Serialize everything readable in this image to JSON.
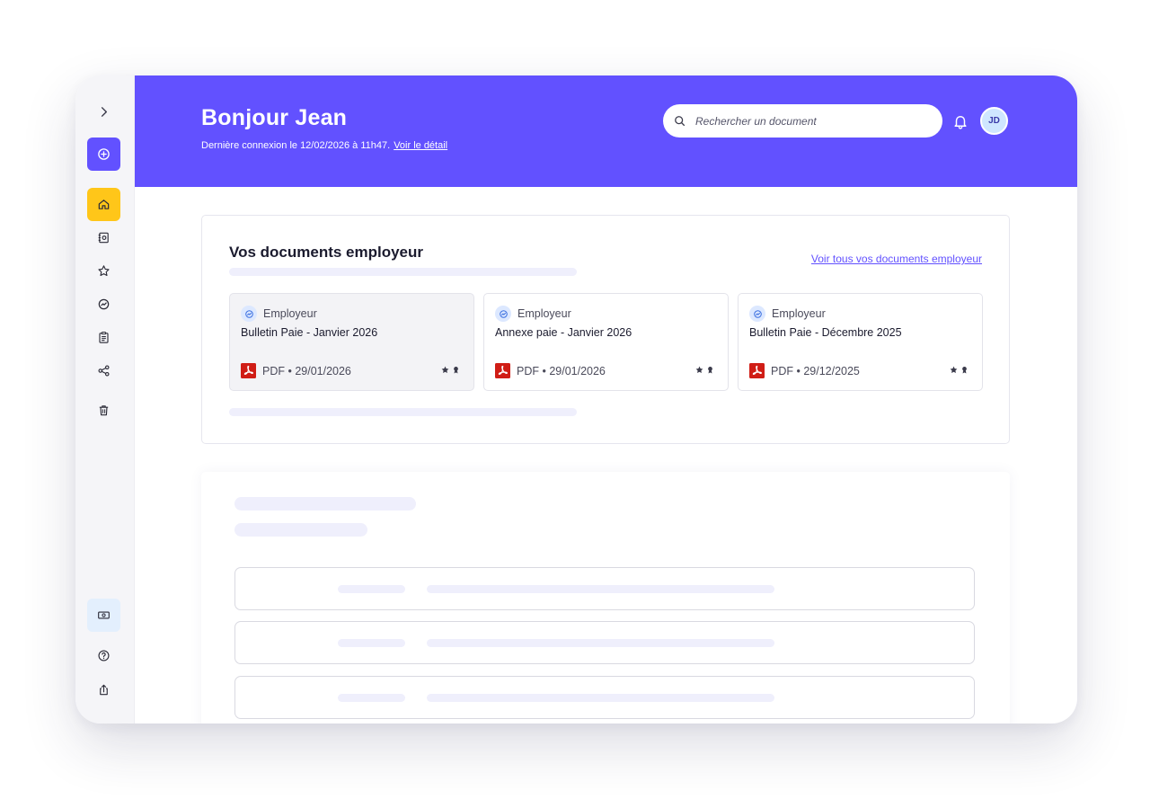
{
  "header": {
    "greeting": "Bonjour Jean",
    "last_login": "Dernière connexion le 12/02/2026 à 11h47.",
    "detail_link": "Voir le détail",
    "search_placeholder": "Rechercher un document",
    "avatar_initials": "JD",
    "accent_color": "#6251ff"
  },
  "sidebar": {
    "items": [
      {
        "icon": "chevron-right-icon",
        "state": "default"
      },
      {
        "icon": "add-circle-icon",
        "state": "primary"
      },
      {
        "icon": "home-icon",
        "state": "active"
      },
      {
        "icon": "document-icon",
        "state": "default"
      },
      {
        "icon": "star-icon",
        "state": "default"
      },
      {
        "icon": "partners-icon",
        "state": "default"
      },
      {
        "icon": "clipboard-icon",
        "state": "default"
      },
      {
        "icon": "share-icon",
        "state": "default"
      },
      {
        "icon": "trash-icon",
        "state": "default"
      }
    ],
    "bottom_items": [
      {
        "icon": "banknote-icon",
        "state": "highlight"
      },
      {
        "icon": "help-icon",
        "state": "default"
      },
      {
        "icon": "export-icon",
        "state": "default"
      }
    ],
    "active_color": "#ffc619"
  },
  "employer_documents": {
    "title": "Vos documents employeur",
    "see_all_link": "Voir tous vos documents employeur",
    "documents": [
      {
        "source": "Employeur",
        "name": "Bulletin Paie - Janvier 2026",
        "meta": "PDF • 29/01/2026"
      },
      {
        "source": "Employeur",
        "name": "Annexe paie - Janvier 2026",
        "meta": "PDF • 29/01/2026"
      },
      {
        "source": "Employeur",
        "name": "Bulletin Paie - Décembre 2025",
        "meta": "PDF • 29/12/2025"
      }
    ]
  }
}
